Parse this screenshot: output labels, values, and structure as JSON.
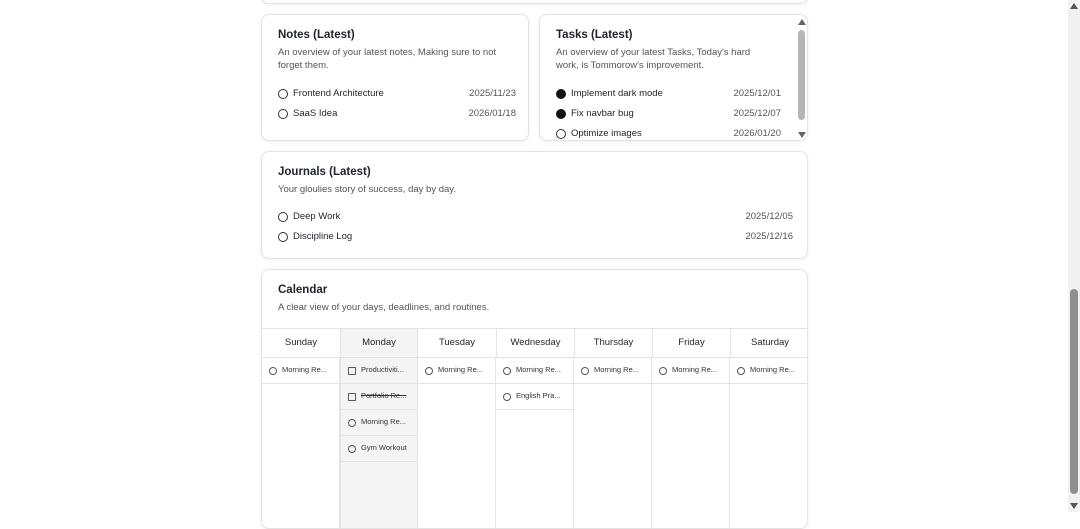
{
  "notes": {
    "title": "Notes (Latest)",
    "description": "An overview of your latest notes, Making sure to not forget them.",
    "items": [
      {
        "label": "Frontend Architecture",
        "date": "2025/11/23"
      },
      {
        "label": "SaaS Idea",
        "date": "2026/01/18"
      }
    ]
  },
  "tasks": {
    "title": "Tasks (Latest)",
    "description": "An overview of your latest Tasks, Today's hard work, is Tommorow's improvement.",
    "items": [
      {
        "label": "Implement dark mode",
        "date": "2025/12/01",
        "done": true
      },
      {
        "label": "Fix navbar bug",
        "date": "2025/12/07",
        "done": true
      },
      {
        "label": "Optimize images",
        "date": "2026/01/20",
        "done": false
      }
    ]
  },
  "journals": {
    "title": "Journals (Latest)",
    "description": "Your gloulies story of success, day by day.",
    "items": [
      {
        "label": "Deep Work",
        "date": "2025/12/05"
      },
      {
        "label": "Discipline Log",
        "date": "2025/12/16"
      }
    ]
  },
  "calendar": {
    "title": "Calendar",
    "description": "A clear view of your days, deadlines, and routines.",
    "days": [
      "Sunday",
      "Monday",
      "Tuesday",
      "Wednesday",
      "Thursday",
      "Friday",
      "Saturday"
    ],
    "events": {
      "sunday": [
        "Morning Re..."
      ],
      "monday": [
        "Productiviti...",
        "Portfolio Re...",
        "Morning Re...",
        "Gym Workout"
      ],
      "tuesday": [
        "Morning Re..."
      ],
      "wednesday": [
        "Morning Re...",
        "English Pra..."
      ],
      "thursday": [
        "Morning Re..."
      ],
      "friday": [
        "Morning Re..."
      ],
      "saturday": [
        "Morning Re..."
      ]
    }
  }
}
